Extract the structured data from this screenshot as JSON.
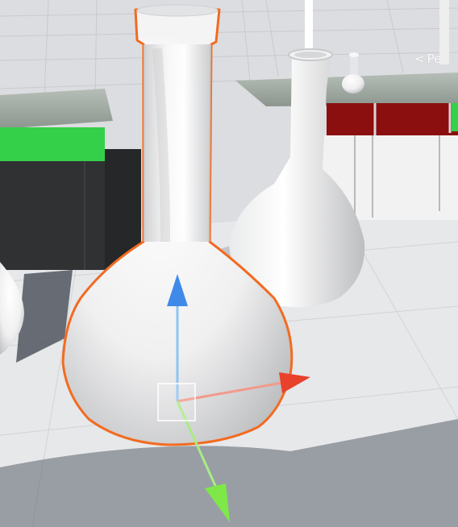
{
  "scene_view": {
    "perspective_label_chevron": "<",
    "perspective_label": "Pe",
    "selected_object": "round-bottom-flask",
    "gizmo_tool": "move",
    "colors": {
      "outline_selection": "#f26b21",
      "axis_x": "#e8412c",
      "axis_y": "#3f8ae8",
      "axis_z": "#7ee848",
      "counter_top": "#98a39b",
      "green_cabinet": "#35d04a",
      "red_cabinet": "#8b0f0f",
      "floor": "#e8e9ea",
      "shadow": "#4a505c"
    }
  }
}
